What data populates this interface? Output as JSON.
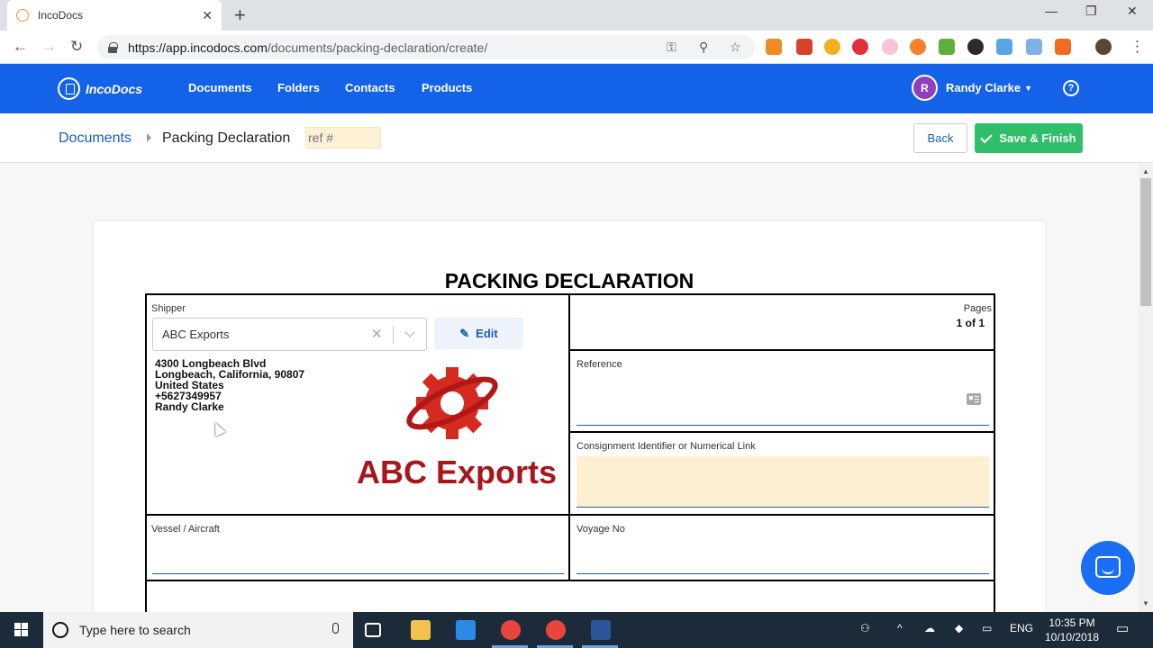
{
  "browser": {
    "tab_title": "IncoDocs",
    "url_host": "https://app.incodocs.com",
    "url_path": "/documents/packing-declaration/create/"
  },
  "app": {
    "brand": "IncoDocs",
    "nav": [
      "Documents",
      "Folders",
      "Contacts",
      "Products"
    ],
    "user_initial": "R",
    "user_name": "Randy Clarke",
    "help_glyph": "?"
  },
  "toolbar": {
    "breadcrumb_root": "Documents",
    "breadcrumb_current": "Packing Declaration",
    "ref_placeholder": "ref #",
    "back_label": "Back",
    "save_label": "Save & Finish"
  },
  "document": {
    "title": "PACKING DECLARATION",
    "shipper": {
      "label": "Shipper",
      "selected": "ABC Exports",
      "edit_label": "Edit",
      "address_lines": [
        "4300 Longbeach Blvd",
        "Longbeach, California, 90807",
        "United States",
        "+5627349957",
        "Randy Clarke"
      ],
      "logo_text": "ABC Exports"
    },
    "pages": {
      "label": "Pages",
      "value": "1 of 1"
    },
    "reference": {
      "label": "Reference"
    },
    "consignment": {
      "label": "Consignment Identifier or Numerical Link"
    },
    "vessel": {
      "label": "Vessel / Aircraft"
    },
    "voyage": {
      "label": "Voyage No"
    }
  },
  "taskbar": {
    "search_placeholder": "Type here to search",
    "lang": "ENG",
    "time": "10:35 PM",
    "date": "10/10/2018"
  },
  "colors": {
    "primary": "#1462e8",
    "save_green": "#2fbf6b",
    "logo_red": "#a8151b",
    "highlight_yellow": "#fdf0d2"
  }
}
